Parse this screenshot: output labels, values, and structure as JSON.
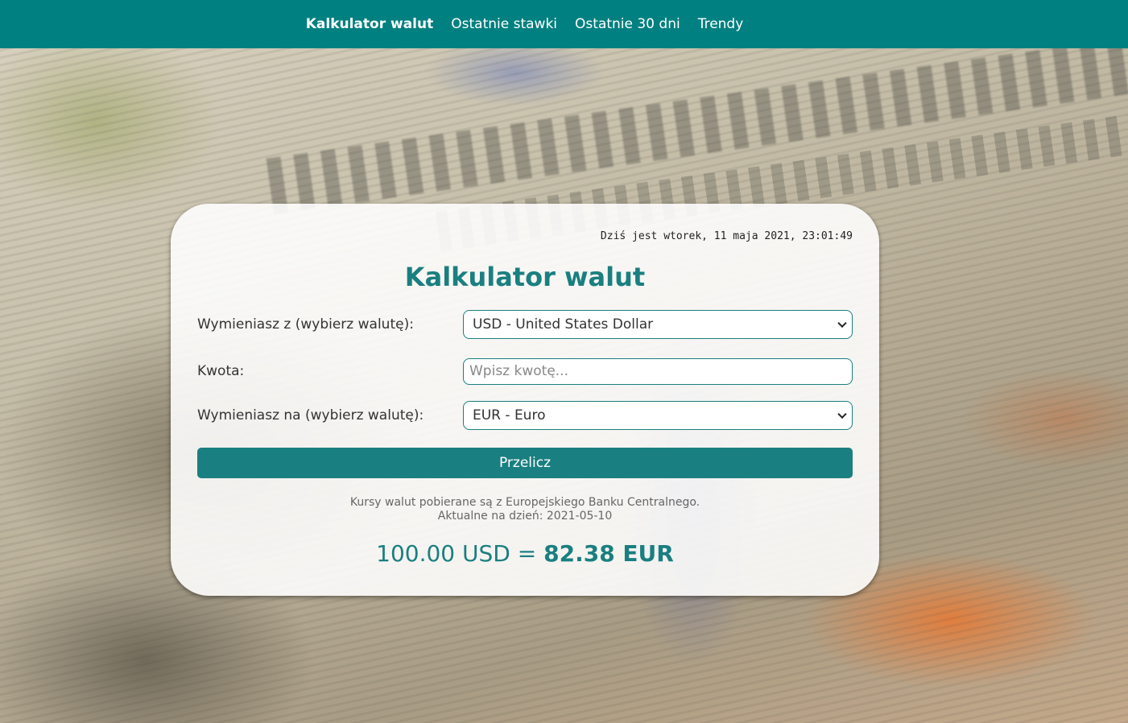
{
  "nav": {
    "items": [
      {
        "label": "Kalkulator walut",
        "active": true
      },
      {
        "label": "Ostatnie stawki",
        "active": false
      },
      {
        "label": "Ostatnie 30 dni",
        "active": false
      },
      {
        "label": "Trendy",
        "active": false
      }
    ]
  },
  "calculator": {
    "datetime": "Dziś jest wtorek, 11 maja 2021, 23:01:49",
    "title": "Kalkulator walut",
    "from_label": "Wymieniasz z (wybierz walutę):",
    "from_value": "USD - United States Dollar",
    "amount_label": "Kwota:",
    "amount_placeholder": "Wpisz kwotę...",
    "to_label": "Wymieniasz na (wybierz walutę):",
    "to_value": "EUR - Euro",
    "button_label": "Przelicz",
    "info_line1": "Kursy walut pobierane są z Europejskiego Banku Centralnego.",
    "info_line2": "Aktualne na dzień: 2021-05-10",
    "result_from": "100.00 USD =",
    "result_to": "82.38 EUR"
  },
  "colors": {
    "accent": "#008080",
    "title": "#1a7f80"
  }
}
